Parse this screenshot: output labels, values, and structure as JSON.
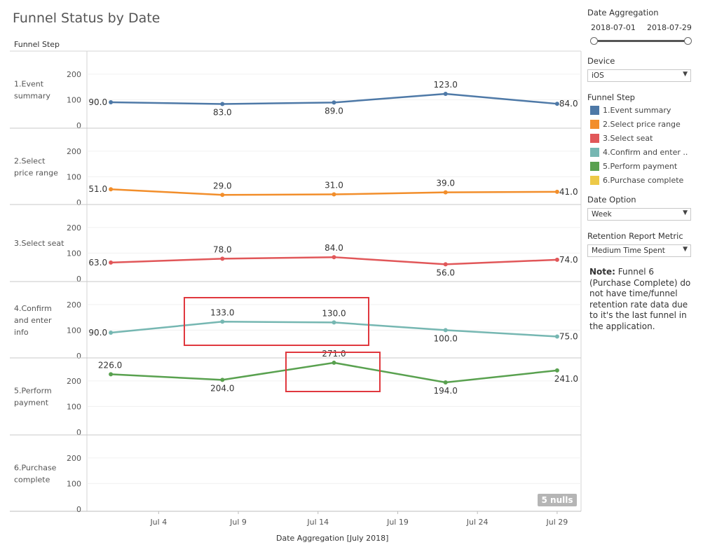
{
  "title": "Funnel Status by Date",
  "funnel_step_header": "Funnel Step",
  "xaxis_title": "Date Aggregation [July 2018]",
  "nulls_badge": "5 nulls",
  "chart_data": {
    "type": "line",
    "layout": "small-multiples",
    "x_tick_labels": [
      "Jul 4",
      "Jul 9",
      "Jul 14",
      "Jul 19",
      "Jul 24",
      "Jul 29"
    ],
    "x_tick_days": [
      4,
      9,
      14,
      19,
      24,
      29
    ],
    "x_days": [
      1,
      8,
      15,
      22,
      29
    ],
    "xlim_days": [
      -0.5,
      30.5
    ],
    "y_ticks": [
      0,
      100,
      200
    ],
    "series": [
      {
        "name": "1.Event summary",
        "label_lines": [
          "1.Event",
          "summary"
        ],
        "color": "#4e79a7",
        "values": [
          90.0,
          83.0,
          89.0,
          123.0,
          84.0
        ],
        "ylim": [
          -10,
          290
        ],
        "label_pos": [
          "left",
          "below",
          "below",
          "above",
          "right"
        ]
      },
      {
        "name": "2.Select price range",
        "label_lines": [
          "2.Select",
          "price range"
        ],
        "color": "#f28e2b",
        "values": [
          51.0,
          29.0,
          31.0,
          39.0,
          41.0
        ],
        "ylim": [
          -10,
          290
        ],
        "label_pos": [
          "left",
          "above",
          "above",
          "above",
          "right"
        ]
      },
      {
        "name": "3.Select seat",
        "label_lines": [
          "3.Select seat"
        ],
        "color": "#e15759",
        "values": [
          63.0,
          78.0,
          84.0,
          56.0,
          74.0
        ],
        "ylim": [
          -10,
          290
        ],
        "label_pos": [
          "left",
          "above",
          "above",
          "below",
          "right"
        ]
      },
      {
        "name": "4.Confirm and enter info",
        "label_lines": [
          "4.Confirm",
          "and enter",
          "info"
        ],
        "color": "#76b7b2",
        "values": [
          90.0,
          133.0,
          130.0,
          100.0,
          75.0
        ],
        "ylim": [
          -10,
          290
        ],
        "label_pos": [
          "left",
          "above",
          "above",
          "below",
          "right"
        ]
      },
      {
        "name": "5.Perform payment",
        "label_lines": [
          "5.Perform",
          "payment"
        ],
        "color": "#59a14f",
        "values": [
          226.0,
          204.0,
          271.0,
          194.0,
          241.0
        ],
        "ylim": [
          -10,
          290
        ],
        "label_pos": [
          "above-left",
          "below",
          "above",
          "below",
          "below-right"
        ]
      },
      {
        "name": "6.Purchase complete",
        "label_lines": [
          "6.Purchase",
          "complete"
        ],
        "color": "#edc948",
        "values": [
          null,
          null,
          null,
          null,
          null
        ],
        "ylim": [
          -10,
          290
        ],
        "label_pos": []
      }
    ]
  },
  "highlight_color": "#e0383e",
  "filters": {
    "date_aggregation": {
      "title": "Date Aggregation",
      "start": "2018-07-01",
      "end": "2018-07-29"
    },
    "device": {
      "title": "Device",
      "value": "iOS"
    },
    "legend": {
      "title": "Funnel Step",
      "items": [
        {
          "label": "1.Event summary",
          "color": "#4e79a7"
        },
        {
          "label": "2.Select price range",
          "color": "#f28e2b"
        },
        {
          "label": "3.Select seat",
          "color": "#e15759"
        },
        {
          "label": "4.Confirm and enter ..",
          "color": "#76b7b2"
        },
        {
          "label": "5.Perform payment",
          "color": "#59a14f"
        },
        {
          "label": "6.Purchase complete",
          "color": "#edc948"
        }
      ]
    },
    "date_option": {
      "title": "Date Option",
      "value": "Week"
    },
    "retention_metric": {
      "title": "Retention Report Metric",
      "value": "Medium Time Spent"
    }
  },
  "note": {
    "bold": "Note:",
    "text": "Funnel 6 (Purchase Complete) do not have time/funnel retention rate data due to it's the last funnel in the application."
  }
}
